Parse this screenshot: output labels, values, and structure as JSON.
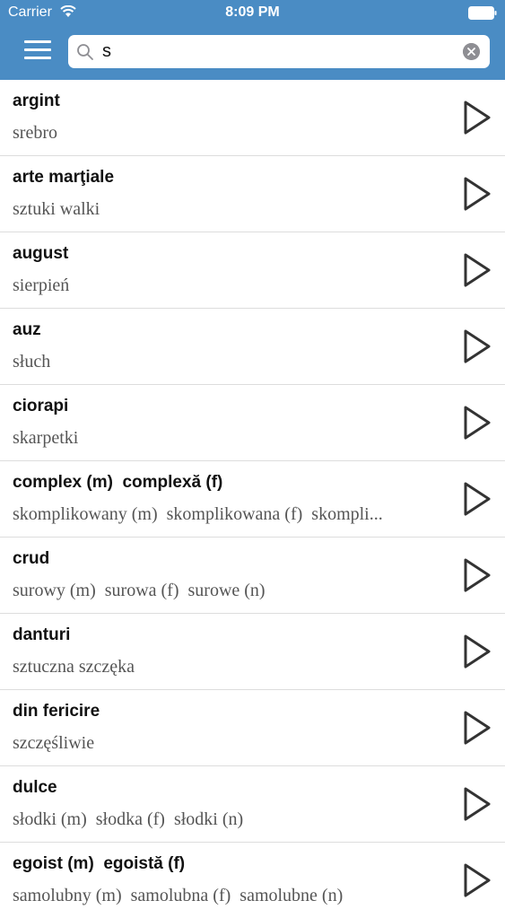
{
  "status_bar": {
    "carrier": "Carrier",
    "time": "8:09 PM"
  },
  "search": {
    "value": "s",
    "icon": "search-icon",
    "clear_icon": "clear-icon"
  },
  "menu_icon": "hamburger-menu-icon",
  "colors": {
    "header": "#4a8cc4",
    "term_text": "#111111",
    "translation_text": "#555555",
    "play_icon": "#333333"
  },
  "entries": [
    {
      "term": "argint",
      "translation": "srebro"
    },
    {
      "term": "arte marţiale",
      "translation": "sztuki walki"
    },
    {
      "term": "august",
      "translation": "sierpień"
    },
    {
      "term": "auz",
      "translation": "słuch"
    },
    {
      "term": "ciorapi",
      "translation": "skarpetki"
    },
    {
      "term": "complex (m)  complexă (f)",
      "translation": "skomplikowany (m)  skomplikowana (f)  skompli..."
    },
    {
      "term": "crud",
      "translation": "surowy (m)  surowa (f)  surowe (n)"
    },
    {
      "term": "danturi",
      "translation": "sztuczna szczęka"
    },
    {
      "term": "din fericire",
      "translation": "szczęśliwie"
    },
    {
      "term": "dulce",
      "translation": "słodki (m)  słodka (f)  słodki (n)"
    },
    {
      "term": "egoist (m)  egoistă (f)",
      "translation": "samolubny (m)  samolubna (f)  samolubne (n)"
    }
  ]
}
